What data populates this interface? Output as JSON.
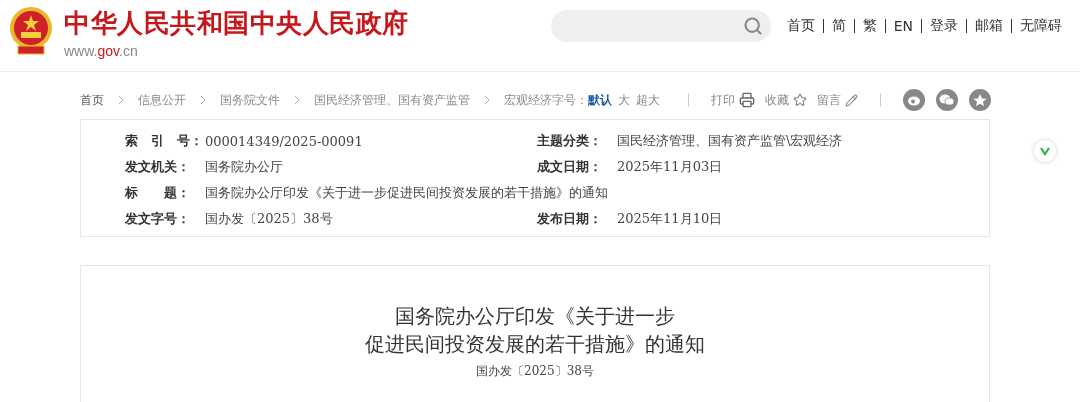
{
  "header": {
    "site_title": "中华人民共和国中央人民政府",
    "url_parts": [
      "www.",
      "gov",
      ".cn"
    ],
    "top_links": [
      "首页",
      "简",
      "繁",
      "EN",
      "登录",
      "邮箱",
      "无障碍"
    ]
  },
  "breadcrumb": [
    "首页",
    "信息公开",
    "国务院文件",
    "国民经济管理、国有资产监管"
  ],
  "font_size": {
    "label": "宏观经济字号：",
    "options": [
      {
        "label": "默认",
        "selected": true
      },
      {
        "label": "大",
        "selected": false
      },
      {
        "label": "超大",
        "selected": false
      }
    ]
  },
  "tools": [
    {
      "label": "打印",
      "kind": "print"
    },
    {
      "label": "收藏",
      "kind": "star"
    },
    {
      "label": "留言",
      "kind": "pencil"
    }
  ],
  "share": [
    {
      "kind": "weibo"
    },
    {
      "kind": "wechat"
    },
    {
      "kind": "favorite"
    }
  ],
  "info": [
    [
      {
        "label": "索　引　号：",
        "value": "000014349/2025-00091"
      },
      {
        "label": "主题分类：",
        "value": "国民经济管理、国有资产监管\\宏观经济"
      }
    ],
    [
      {
        "label": "发文机关：",
        "value": "国务院办公厅"
      },
      {
        "label": "成文日期：",
        "value": "2025年11月03日"
      }
    ],
    [
      {
        "label": "标　　题：",
        "value": "国务院办公厅印发《关于进一步促进民间投资发展的若干措施》的通知"
      }
    ],
    [
      {
        "label": "发文字号：",
        "value": "国办发〔2025〕38号"
      },
      {
        "label": "发布日期：",
        "value": "2025年11月10日"
      }
    ]
  ],
  "document": {
    "title_lines": [
      "国务院办公厅印发《关于进一步",
      "促进民间投资发展的若干措施》的通知"
    ],
    "number": "国办发〔2025〕38号"
  }
}
